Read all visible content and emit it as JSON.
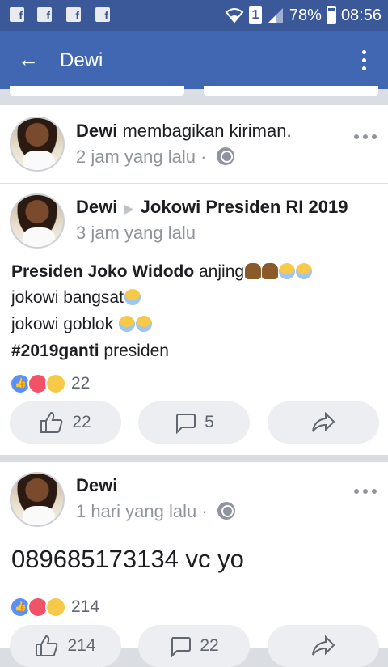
{
  "status_bar": {
    "fb_icon": "f",
    "sim": "1",
    "battery": "78%",
    "time": "08:56"
  },
  "app_bar": {
    "back_icon": "←",
    "title": "Dewi"
  },
  "posts": [
    {
      "author": "Dewi",
      "action": "membagikan kiriman.",
      "time": "2 jam yang lalu",
      "dot": "·"
    },
    {
      "author": "Dewi",
      "target": "Jokowi Presiden RI 2019",
      "time": "3 jam yang lalu",
      "lines": [
        {
          "bold": "Presiden Joko Widodo",
          "text": " anjing"
        },
        {
          "text": "jokowi bangsat"
        },
        {
          "text": "jokowi goblok "
        },
        {
          "bold": "#2019ganti",
          "text": " presiden"
        }
      ],
      "reaction_count": "22",
      "like_count": "22",
      "comment_count": "5"
    },
    {
      "author": "Dewi",
      "time": "1 hari yang lalu",
      "dot": "·",
      "text": "089685173134 vc yo",
      "reaction_count": "214",
      "like_count": "214",
      "comment_count": "22"
    }
  ],
  "colors": {
    "status_bar": "#3b5998",
    "app_bar": "#4267b2",
    "like": "#5890ff",
    "love": "#f25268"
  }
}
